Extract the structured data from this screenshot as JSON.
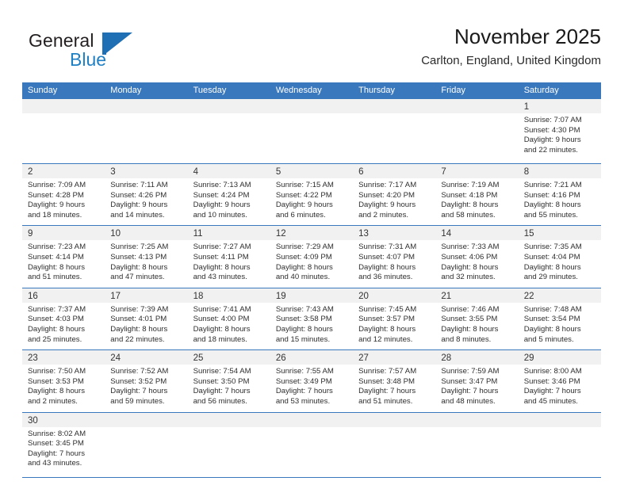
{
  "brand": {
    "name_part1": "General",
    "name_part2": "Blue",
    "mark_icon": "triangle-logo-icon",
    "accent_color": "#1f6fb5"
  },
  "header": {
    "title": "November 2025",
    "subtitle": "Carlton, England, United Kingdom"
  },
  "theme": {
    "header_blue": "#3a78bd",
    "day_band_gray": "#f1f1f1",
    "text_color": "#2e2e2e"
  },
  "weekdays": [
    "Sunday",
    "Monday",
    "Tuesday",
    "Wednesday",
    "Thursday",
    "Friday",
    "Saturday"
  ],
  "weeks": [
    [
      {
        "day": "",
        "empty": true,
        "lines": []
      },
      {
        "day": "",
        "empty": true,
        "lines": []
      },
      {
        "day": "",
        "empty": true,
        "lines": []
      },
      {
        "day": "",
        "empty": true,
        "lines": []
      },
      {
        "day": "",
        "empty": true,
        "lines": []
      },
      {
        "day": "",
        "empty": true,
        "lines": []
      },
      {
        "day": "1",
        "empty": false,
        "lines": [
          "Sunrise: 7:07 AM",
          "Sunset: 4:30 PM",
          "Daylight: 9 hours",
          "and 22 minutes."
        ]
      }
    ],
    [
      {
        "day": "2",
        "empty": false,
        "lines": [
          "Sunrise: 7:09 AM",
          "Sunset: 4:28 PM",
          "Daylight: 9 hours",
          "and 18 minutes."
        ]
      },
      {
        "day": "3",
        "empty": false,
        "lines": [
          "Sunrise: 7:11 AM",
          "Sunset: 4:26 PM",
          "Daylight: 9 hours",
          "and 14 minutes."
        ]
      },
      {
        "day": "4",
        "empty": false,
        "lines": [
          "Sunrise: 7:13 AM",
          "Sunset: 4:24 PM",
          "Daylight: 9 hours",
          "and 10 minutes."
        ]
      },
      {
        "day": "5",
        "empty": false,
        "lines": [
          "Sunrise: 7:15 AM",
          "Sunset: 4:22 PM",
          "Daylight: 9 hours",
          "and 6 minutes."
        ]
      },
      {
        "day": "6",
        "empty": false,
        "lines": [
          "Sunrise: 7:17 AM",
          "Sunset: 4:20 PM",
          "Daylight: 9 hours",
          "and 2 minutes."
        ]
      },
      {
        "day": "7",
        "empty": false,
        "lines": [
          "Sunrise: 7:19 AM",
          "Sunset: 4:18 PM",
          "Daylight: 8 hours",
          "and 58 minutes."
        ]
      },
      {
        "day": "8",
        "empty": false,
        "lines": [
          "Sunrise: 7:21 AM",
          "Sunset: 4:16 PM",
          "Daylight: 8 hours",
          "and 55 minutes."
        ]
      }
    ],
    [
      {
        "day": "9",
        "empty": false,
        "lines": [
          "Sunrise: 7:23 AM",
          "Sunset: 4:14 PM",
          "Daylight: 8 hours",
          "and 51 minutes."
        ]
      },
      {
        "day": "10",
        "empty": false,
        "lines": [
          "Sunrise: 7:25 AM",
          "Sunset: 4:13 PM",
          "Daylight: 8 hours",
          "and 47 minutes."
        ]
      },
      {
        "day": "11",
        "empty": false,
        "lines": [
          "Sunrise: 7:27 AM",
          "Sunset: 4:11 PM",
          "Daylight: 8 hours",
          "and 43 minutes."
        ]
      },
      {
        "day": "12",
        "empty": false,
        "lines": [
          "Sunrise: 7:29 AM",
          "Sunset: 4:09 PM",
          "Daylight: 8 hours",
          "and 40 minutes."
        ]
      },
      {
        "day": "13",
        "empty": false,
        "lines": [
          "Sunrise: 7:31 AM",
          "Sunset: 4:07 PM",
          "Daylight: 8 hours",
          "and 36 minutes."
        ]
      },
      {
        "day": "14",
        "empty": false,
        "lines": [
          "Sunrise: 7:33 AM",
          "Sunset: 4:06 PM",
          "Daylight: 8 hours",
          "and 32 minutes."
        ]
      },
      {
        "day": "15",
        "empty": false,
        "lines": [
          "Sunrise: 7:35 AM",
          "Sunset: 4:04 PM",
          "Daylight: 8 hours",
          "and 29 minutes."
        ]
      }
    ],
    [
      {
        "day": "16",
        "empty": false,
        "lines": [
          "Sunrise: 7:37 AM",
          "Sunset: 4:03 PM",
          "Daylight: 8 hours",
          "and 25 minutes."
        ]
      },
      {
        "day": "17",
        "empty": false,
        "lines": [
          "Sunrise: 7:39 AM",
          "Sunset: 4:01 PM",
          "Daylight: 8 hours",
          "and 22 minutes."
        ]
      },
      {
        "day": "18",
        "empty": false,
        "lines": [
          "Sunrise: 7:41 AM",
          "Sunset: 4:00 PM",
          "Daylight: 8 hours",
          "and 18 minutes."
        ]
      },
      {
        "day": "19",
        "empty": false,
        "lines": [
          "Sunrise: 7:43 AM",
          "Sunset: 3:58 PM",
          "Daylight: 8 hours",
          "and 15 minutes."
        ]
      },
      {
        "day": "20",
        "empty": false,
        "lines": [
          "Sunrise: 7:45 AM",
          "Sunset: 3:57 PM",
          "Daylight: 8 hours",
          "and 12 minutes."
        ]
      },
      {
        "day": "21",
        "empty": false,
        "lines": [
          "Sunrise: 7:46 AM",
          "Sunset: 3:55 PM",
          "Daylight: 8 hours",
          "and 8 minutes."
        ]
      },
      {
        "day": "22",
        "empty": false,
        "lines": [
          "Sunrise: 7:48 AM",
          "Sunset: 3:54 PM",
          "Daylight: 8 hours",
          "and 5 minutes."
        ]
      }
    ],
    [
      {
        "day": "23",
        "empty": false,
        "lines": [
          "Sunrise: 7:50 AM",
          "Sunset: 3:53 PM",
          "Daylight: 8 hours",
          "and 2 minutes."
        ]
      },
      {
        "day": "24",
        "empty": false,
        "lines": [
          "Sunrise: 7:52 AM",
          "Sunset: 3:52 PM",
          "Daylight: 7 hours",
          "and 59 minutes."
        ]
      },
      {
        "day": "25",
        "empty": false,
        "lines": [
          "Sunrise: 7:54 AM",
          "Sunset: 3:50 PM",
          "Daylight: 7 hours",
          "and 56 minutes."
        ]
      },
      {
        "day": "26",
        "empty": false,
        "lines": [
          "Sunrise: 7:55 AM",
          "Sunset: 3:49 PM",
          "Daylight: 7 hours",
          "and 53 minutes."
        ]
      },
      {
        "day": "27",
        "empty": false,
        "lines": [
          "Sunrise: 7:57 AM",
          "Sunset: 3:48 PM",
          "Daylight: 7 hours",
          "and 51 minutes."
        ]
      },
      {
        "day": "28",
        "empty": false,
        "lines": [
          "Sunrise: 7:59 AM",
          "Sunset: 3:47 PM",
          "Daylight: 7 hours",
          "and 48 minutes."
        ]
      },
      {
        "day": "29",
        "empty": false,
        "lines": [
          "Sunrise: 8:00 AM",
          "Sunset: 3:46 PM",
          "Daylight: 7 hours",
          "and 45 minutes."
        ]
      }
    ],
    [
      {
        "day": "30",
        "empty": false,
        "lines": [
          "Sunrise: 8:02 AM",
          "Sunset: 3:45 PM",
          "Daylight: 7 hours",
          "and 43 minutes."
        ]
      },
      {
        "day": "",
        "empty": true,
        "lines": []
      },
      {
        "day": "",
        "empty": true,
        "lines": []
      },
      {
        "day": "",
        "empty": true,
        "lines": []
      },
      {
        "day": "",
        "empty": true,
        "lines": []
      },
      {
        "day": "",
        "empty": true,
        "lines": []
      },
      {
        "day": "",
        "empty": true,
        "lines": []
      }
    ]
  ]
}
